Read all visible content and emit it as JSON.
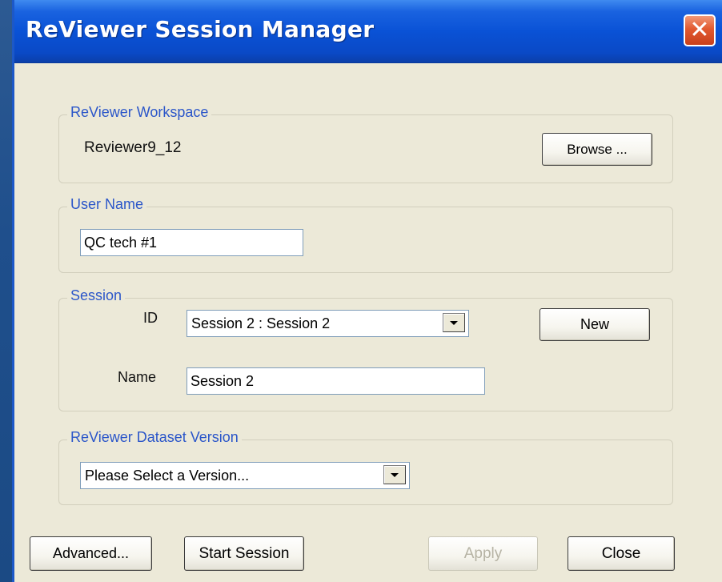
{
  "window": {
    "title": "ReViewer Session Manager",
    "close_glyph": "✕"
  },
  "workspace": {
    "group_label": "ReViewer Workspace",
    "value": "Reviewer9_12",
    "browse_label": "Browse ..."
  },
  "user": {
    "group_label": "User Name",
    "value": "QC tech #1"
  },
  "session": {
    "group_label": "Session",
    "id_label": "ID",
    "id_selected": "Session 2 : Session 2",
    "new_label": "New",
    "name_label": "Name",
    "name_value": "Session 2"
  },
  "dataset_version": {
    "group_label": "ReViewer Dataset Version",
    "selected": "Please Select a Version..."
  },
  "buttons": {
    "advanced": "Advanced...",
    "start_session": "Start Session",
    "apply": "Apply",
    "close": "Close"
  },
  "colors": {
    "titlebar": "#0a52d6",
    "window_bg": "#ece9d8",
    "group_label": "#2b56c9",
    "close_button": "#e2592f",
    "desktop": "#1f4f8c"
  },
  "icons": {
    "close": "close-icon",
    "dropdown": "chevron-down-icon"
  }
}
